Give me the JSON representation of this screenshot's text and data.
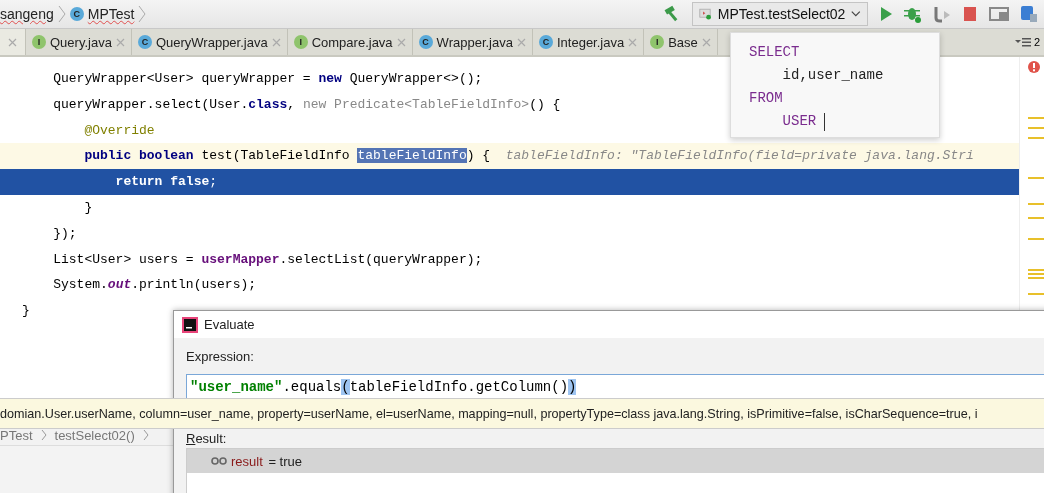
{
  "navigation_bar": {
    "breadcrumbs": [
      {
        "label": "sangeng"
      },
      {
        "label": "MPTest",
        "icon_letter": "C"
      }
    ],
    "run_configuration": "MPTest.testSelect02"
  },
  "tabs": [
    {
      "selected": true
    },
    {
      "label": "Query.java",
      "icon_letter": "I",
      "kind": "interface",
      "selected": false
    },
    {
      "label": "QueryWrapper.java",
      "icon_letter": "C",
      "kind": "class",
      "selected": false
    },
    {
      "label": "Compare.java",
      "icon_letter": "I",
      "kind": "interface",
      "selected": false
    },
    {
      "label": "Wrapper.java",
      "icon_letter": "C",
      "kind": "class",
      "selected": false
    },
    {
      "label": "Integer.java",
      "icon_letter": "C",
      "kind": "class",
      "selected": false
    },
    {
      "label": "Base",
      "icon_letter": "I",
      "kind": "interface",
      "selected": false
    }
  ],
  "tab_count": "2",
  "editor": {
    "lines": [
      {
        "current_line": false,
        "execution_point": false,
        "tokens": [
          {
            "t": "    QueryWrapper<User> queryWrapper = ",
            "kind": "plain"
          },
          {
            "t": "new",
            "kind": "keyword"
          },
          {
            "t": " QueryWrapper<>();",
            "kind": "plain"
          }
        ]
      },
      {
        "current_line": false,
        "execution_point": false,
        "tokens": [
          {
            "t": "    queryWrapper.select(User.",
            "kind": "plain"
          },
          {
            "t": "class",
            "kind": "keyword"
          },
          {
            "t": ", ",
            "kind": "plain"
          },
          {
            "t": "new Predicate<TableFieldInfo>",
            "kind": "hint"
          },
          {
            "t": "() {",
            "kind": "plain"
          }
        ]
      },
      {
        "current_line": false,
        "execution_point": false,
        "tokens": [
          {
            "t": "        @Override",
            "kind": "annotation"
          }
        ]
      },
      {
        "current_line": true,
        "execution_point": false,
        "tokens": [
          {
            "t": "        public",
            "kind": "keyword"
          },
          {
            "t": " boolean",
            "kind": "keyword"
          },
          {
            "t": " test(TableFieldInfo ",
            "kind": "plain"
          },
          {
            "t": "tableFieldInfo",
            "kind": "selection"
          },
          {
            "t": ") {  ",
            "kind": "plain"
          },
          {
            "t": "tableFieldInfo: \"TableFieldInfo(field=private java.lang.Stri",
            "kind": "inline_value"
          }
        ]
      },
      {
        "current_line": false,
        "execution_point": true,
        "tokens": [
          {
            "t": "            return",
            "kind": "keyword"
          },
          {
            "t": " false",
            "kind": "keyword"
          },
          {
            "t": ";",
            "kind": "plain"
          }
        ]
      },
      {
        "current_line": false,
        "execution_point": false,
        "tokens": [
          {
            "t": "        }",
            "kind": "plain"
          }
        ]
      },
      {
        "current_line": false,
        "execution_point": false,
        "tokens": [
          {
            "t": "    });",
            "kind": "plain"
          }
        ]
      },
      {
        "current_line": false,
        "execution_point": false,
        "tokens": [
          {
            "t": "    List<User> users = ",
            "kind": "plain"
          },
          {
            "t": "userMapper",
            "kind": "field"
          },
          {
            "t": ".selectList(queryWrapper);",
            "kind": "plain"
          }
        ]
      },
      {
        "current_line": false,
        "execution_point": false,
        "tokens": [
          {
            "t": "    System.",
            "kind": "plain"
          },
          {
            "t": "out",
            "kind": "static_field"
          },
          {
            "t": ".println(users);",
            "kind": "plain"
          }
        ]
      },
      {
        "current_line": false,
        "execution_point": false,
        "tokens": [
          {
            "t": "}",
            "kind": "plain"
          }
        ]
      }
    ]
  },
  "sql_popup": {
    "lines": [
      [
        {
          "t": "SELECT",
          "kind": "keyword"
        }
      ],
      [
        {
          "t": "    id,user_name",
          "kind": "plain"
        }
      ],
      [
        {
          "t": "FROM",
          "kind": "keyword"
        }
      ],
      [
        {
          "t": "    USER",
          "kind": "keyword"
        }
      ]
    ]
  },
  "bottom_breadcrumbs": [
    "PTest",
    "testSelect02()"
  ],
  "tooltip": "domian.User.userName, column=user_name, property=userName, el=userName, mapping=null, propertyType=class java.lang.String, isPrimitive=false, isCharSequence=true, i",
  "evaluate_dialog": {
    "title": "Evaluate",
    "expression_label": "Expression:",
    "expression": [
      {
        "t": "\"user_name\"",
        "kind": "string"
      },
      {
        "t": ".equals",
        "kind": "plain"
      },
      {
        "t": "(",
        "kind": "brace_match"
      },
      {
        "t": "tableFieldInfo.getColumn()",
        "kind": "plain"
      },
      {
        "t": ")",
        "kind": "brace_match"
      }
    ],
    "result_label": "Result:",
    "result": {
      "name": "result",
      "value": " = true",
      "selected": true
    }
  }
}
